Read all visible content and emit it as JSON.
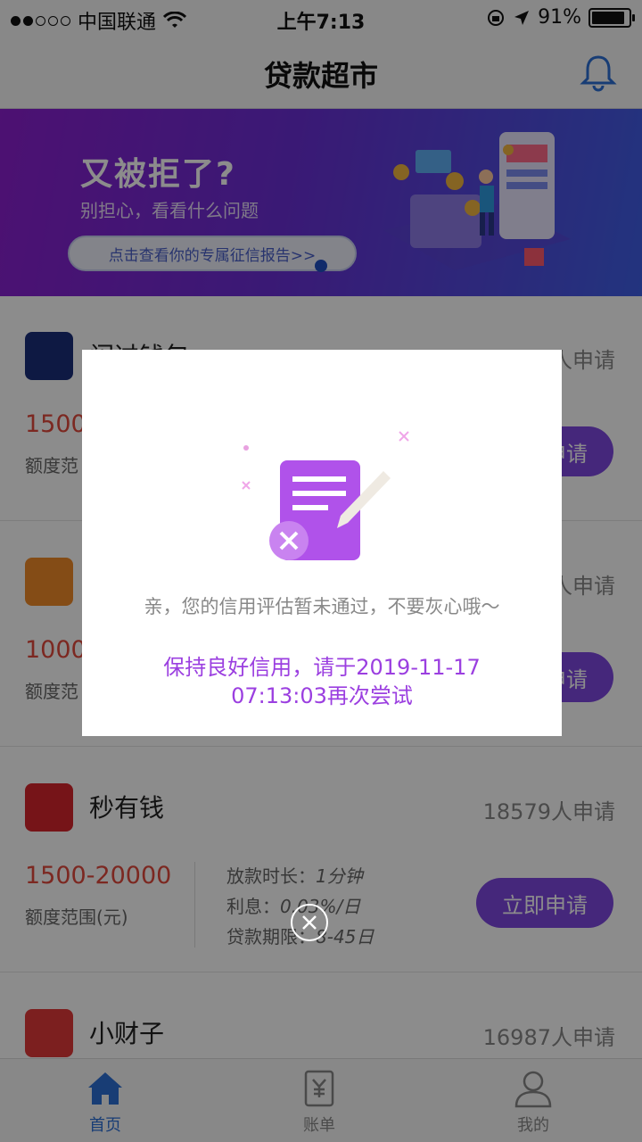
{
  "status_bar": {
    "carrier": "中国联通",
    "time": "上午7:13",
    "battery": "91%"
  },
  "nav": {
    "title": "贷款超市"
  },
  "banner": {
    "headline": "又被拒了?",
    "subtitle": "别担心，看看什么问题",
    "cta": "点击查看你的专属征信报告>>"
  },
  "products": [
    {
      "name": "闪过钱包",
      "count": "人申请",
      "amount": "1500",
      "amount_label": "额度范",
      "apply": "立即申请"
    },
    {
      "name": "",
      "count": "人申请",
      "amount": "1000",
      "amount_label": "额度范",
      "apply": "立即申请"
    },
    {
      "name": "秒有钱",
      "count": "18579人申请",
      "amount": "1500-20000",
      "amount_label": "额度范围(元)",
      "speed_label": "放款时长：",
      "speed": "1分钟",
      "rate_label": "利息：",
      "rate": "0.03%/日",
      "term_label": "贷款期限：",
      "term": "8-45日",
      "apply": "立即申请"
    },
    {
      "name": "小财子",
      "count": "16987人申请"
    }
  ],
  "tabs": [
    {
      "label": "首页",
      "active": true
    },
    {
      "label": "账单",
      "active": false
    },
    {
      "label": "我的",
      "active": false
    }
  ],
  "modal": {
    "message": "亲，您的信用评估暂未通过，不要灰心哦～",
    "retry_line1": "保持良好信用，请于2019-11-17",
    "retry_line2": "07:13:03再次尝试"
  },
  "colors": {
    "accent": "#7e47e0",
    "amount": "#e24a3d",
    "tab_active": "#2d6fd6",
    "modal_text": "#9b3fe0"
  }
}
